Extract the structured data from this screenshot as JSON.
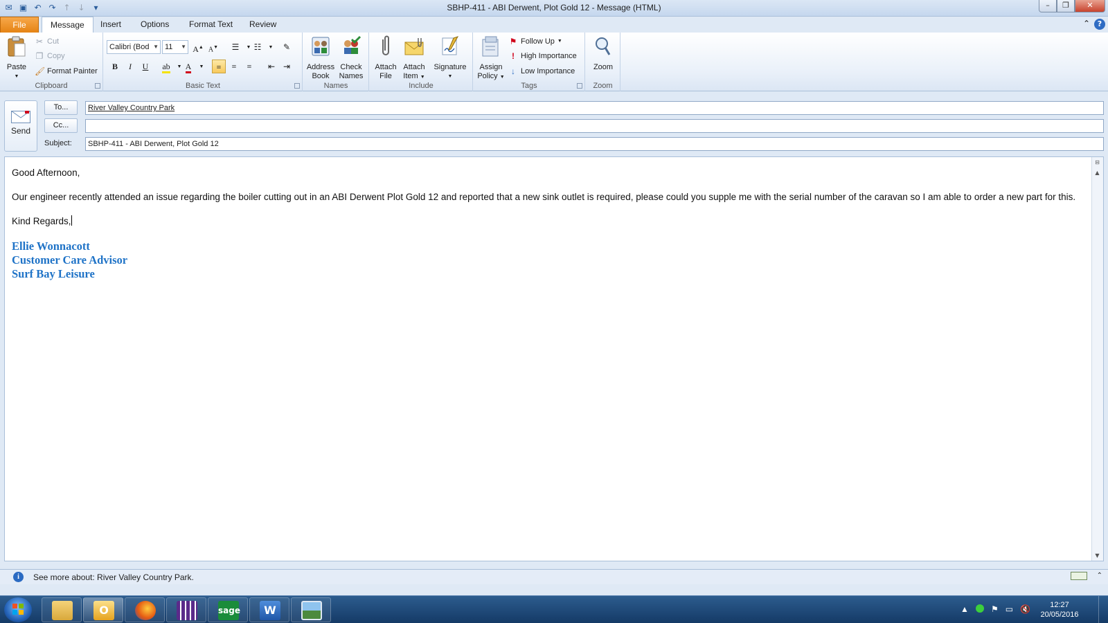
{
  "window": {
    "title": "SBHP-411 - ABI Derwent, Plot Gold 12  -  Message (HTML)"
  },
  "tabs": [
    {
      "label": "File"
    },
    {
      "label": "Message"
    },
    {
      "label": "Insert"
    },
    {
      "label": "Options"
    },
    {
      "label": "Format Text"
    },
    {
      "label": "Review"
    }
  ],
  "ribbon": {
    "clipboard": {
      "label": "Clipboard",
      "paste": "Paste",
      "cut": "Cut",
      "copy": "Copy",
      "format_painter": "Format Painter"
    },
    "basic_text": {
      "label": "Basic Text",
      "font_name": "Calibri (Bod",
      "font_size": "11",
      "bold": "B",
      "italic": "I",
      "underline": "U"
    },
    "names": {
      "label": "Names",
      "address_book_1": "Address",
      "address_book_2": "Book",
      "check_names_1": "Check",
      "check_names_2": "Names"
    },
    "include": {
      "label": "Include",
      "attach_file_1": "Attach",
      "attach_file_2": "File",
      "attach_item_1": "Attach",
      "attach_item_2": "Item",
      "signature": "Signature"
    },
    "tags": {
      "label": "Tags",
      "assign_policy_1": "Assign",
      "assign_policy_2": "Policy",
      "follow_up": "Follow Up",
      "high_importance": "High Importance",
      "low_importance": "Low Importance"
    },
    "zoom": {
      "label": "Zoom",
      "zoom": "Zoom"
    }
  },
  "header": {
    "send_label": "Send",
    "to_button": "To...",
    "cc_button": "Cc...",
    "subject_label": "Subject:",
    "to_value": "River Valley Country Park",
    "cc_value": "",
    "subject_value": "SBHP-411 - ABI Derwent, Plot Gold 12"
  },
  "body": {
    "greeting": "Good Afternoon,",
    "paragraph": "Our engineer recently attended an issue regarding the boiler cutting out in an ABI Derwent Plot Gold 12 and reported that a new sink outlet is required, please could you supple me with the serial number of the caravan so I am able to order a new part for this.",
    "closing": "Kind Regards,",
    "signature": {
      "name": "Ellie Wonnacott",
      "role": "Customer Care Advisor",
      "company": "Surf Bay Leisure"
    }
  },
  "people_pane": {
    "text": "See more about: River Valley Country Park."
  },
  "taskbar": {
    "time": "12:27",
    "date": "20/05/2016",
    "sage_label": "sage",
    "word_label": "W"
  },
  "colors": {
    "signature": "#1f73c7",
    "file_tab": "#e58314",
    "taskbar": "#153a66"
  }
}
